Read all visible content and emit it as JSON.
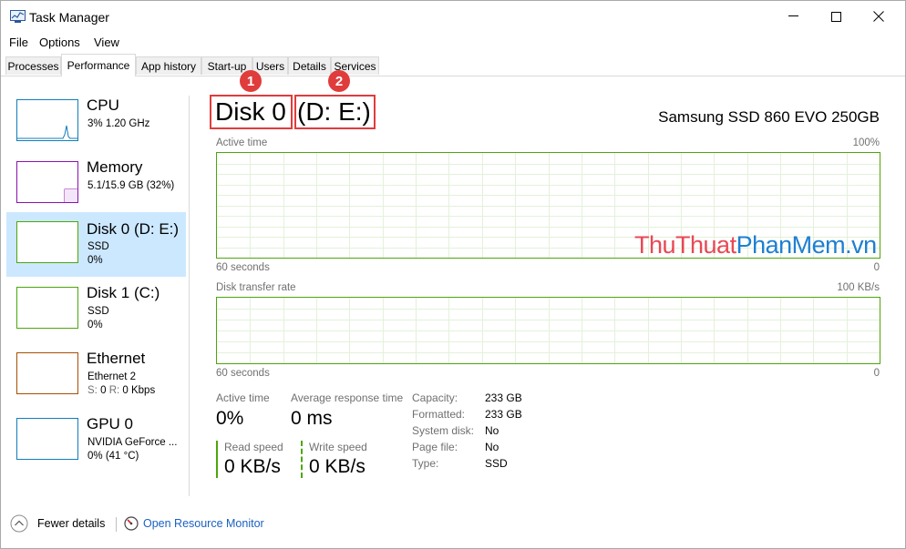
{
  "window": {
    "title": "Task Manager",
    "icon": "task-manager-icon"
  },
  "menu": [
    "File",
    "Options",
    "View"
  ],
  "tabs": [
    "Processes",
    "Performance",
    "App history",
    "Start-up",
    "Users",
    "Details",
    "Services"
  ],
  "active_tab": "Performance",
  "sidebar": [
    {
      "name": "CPU",
      "line1": "3%  1.20 GHz",
      "line2": "",
      "color": "#117dbb"
    },
    {
      "name": "Memory",
      "line1": "5.1/15.9 GB (32%)",
      "line2": "",
      "color": "#8b12ae"
    },
    {
      "name": "Disk 0 (D: E:)",
      "line1": "SSD",
      "line2": "0%",
      "color": "#4da60c",
      "selected": true
    },
    {
      "name": "Disk 1 (C:)",
      "line1": "SSD",
      "line2": "0%",
      "color": "#4da60c"
    },
    {
      "name": "Ethernet",
      "line1": "Ethernet 2",
      "line2_label_s": "S:",
      "line2_val_s": "0",
      "line2_label_r": "R:",
      "line2_val_r": "0 Kbps",
      "color": "#a74f01"
    },
    {
      "name": "GPU 0",
      "line1": "NVIDIA GeForce ...",
      "line2": "0%  (41 °C)",
      "color": "#117dbb"
    }
  ],
  "main": {
    "disk_name": "Disk 0",
    "disk_volumes": "(D: E:)",
    "model": "Samsung SSD 860 EVO 250GB",
    "callouts": [
      "1",
      "2"
    ],
    "graph1": {
      "label": "Active time",
      "max": "100%",
      "duration": "60 seconds",
      "min": "0"
    },
    "graph2": {
      "label": "Disk transfer rate",
      "max": "100 KB/s",
      "duration": "60 seconds",
      "min": "0"
    },
    "stats": {
      "active_time_label": "Active time",
      "active_time_value": "0%",
      "avg_resp_label": "Average response time",
      "avg_resp_value": "0 ms",
      "read_label": "Read speed",
      "read_value": "0 KB/s",
      "write_label": "Write speed",
      "write_value": "0 KB/s"
    },
    "properties": [
      {
        "label": "Capacity:",
        "value": "233 GB"
      },
      {
        "label": "Formatted:",
        "value": "233 GB"
      },
      {
        "label": "System disk:",
        "value": "No"
      },
      {
        "label": "Page file:",
        "value": "No"
      },
      {
        "label": "Type:",
        "value": "SSD"
      }
    ]
  },
  "watermark": {
    "part1": "Thu",
    "part2": "Thuat",
    "part3": "Phan",
    "part4": "Mem",
    "part5": ".vn"
  },
  "footer": {
    "fewer_details": "Fewer details",
    "open_resource_monitor": "Open Resource Monitor"
  },
  "colors": {
    "disk_green": "#4da60c",
    "selection": "#cce8ff",
    "callout_red": "#e03c3c",
    "link_blue": "#1a61c0"
  }
}
